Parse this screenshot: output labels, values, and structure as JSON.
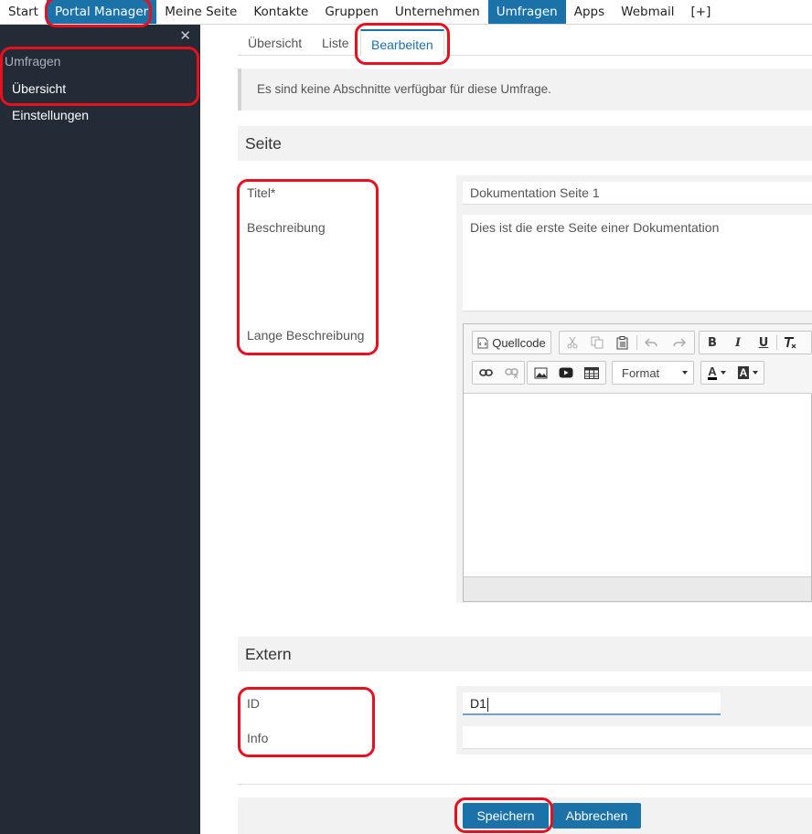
{
  "topnav": {
    "items": [
      {
        "label": "Start"
      },
      {
        "label": "Portal Manager"
      },
      {
        "label": "Meine Seite"
      },
      {
        "label": "Kontakte"
      },
      {
        "label": "Gruppen"
      },
      {
        "label": "Unternehmen"
      },
      {
        "label": "Umfragen"
      },
      {
        "label": "Apps"
      },
      {
        "label": "Webmail"
      },
      {
        "label": "[+]"
      }
    ],
    "active": "Umfragen"
  },
  "sidebar": {
    "close_glyph": "✕",
    "section_title": "Umfragen",
    "items": [
      {
        "label": "Übersicht"
      },
      {
        "label": "Einstellungen"
      }
    ]
  },
  "tabs": [
    {
      "label": "Übersicht"
    },
    {
      "label": "Liste"
    },
    {
      "label": "Bearbeiten"
    }
  ],
  "notice": "Es sind keine Abschnitte verfügbar für diese Umfrage.",
  "seite": {
    "heading": "Seite",
    "titel_label": "Titel*",
    "titel_value": "Dokumentation Seite 1",
    "beschreibung_label": "Beschreibung",
    "beschreibung_value": "Dies ist die erste Seite einer Dokumentation",
    "lange_beschreibung_label": "Lange Beschreibung"
  },
  "editor": {
    "source_label": "Quellcode",
    "format_label": "Format",
    "icons": [
      "source-icon",
      "cut-icon",
      "copy-icon",
      "paste-text-icon",
      "undo-icon",
      "redo-icon",
      "bold-icon",
      "italic-icon",
      "underline-icon",
      "remove-format-icon",
      "link-icon",
      "unlink-icon",
      "image-icon",
      "youtube-icon",
      "table-icon",
      "text-color-icon",
      "background-color-icon"
    ],
    "bold": "B",
    "italic": "I",
    "underline": "U",
    "text_color": "A",
    "bg_color": "A"
  },
  "extern": {
    "heading": "Extern",
    "id_label": "ID",
    "id_value": "D1",
    "info_label": "Info",
    "info_value": ""
  },
  "actions": {
    "save_label": "Speichern",
    "cancel_label": "Abbrechen"
  },
  "colors": {
    "accent": "#1a72a8",
    "sidebar_bg": "#232b36",
    "highlight": "#e8101e"
  }
}
